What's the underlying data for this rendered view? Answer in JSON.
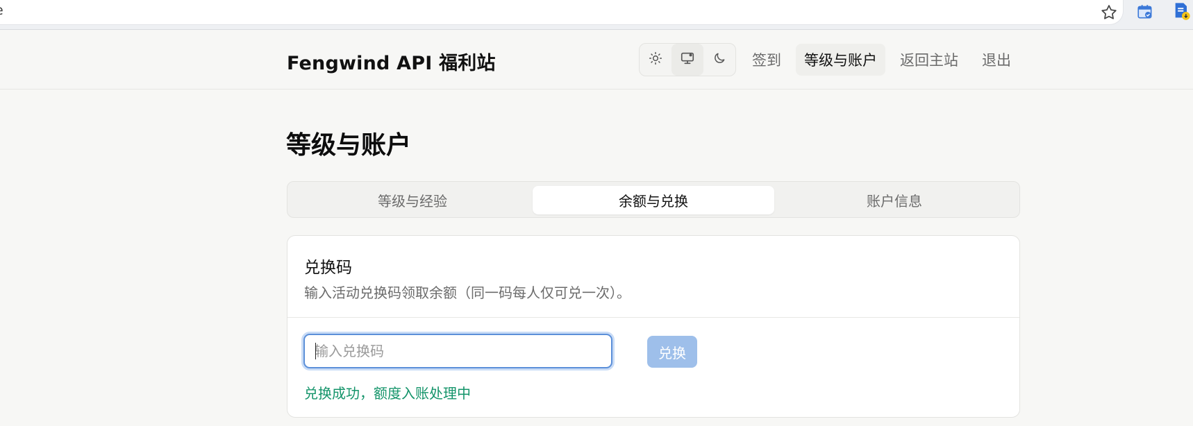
{
  "browser": {
    "address_text": "ne"
  },
  "header": {
    "brand": "Fengwind API 福利站",
    "nav": [
      {
        "label": "签到"
      },
      {
        "label": "等级与账户"
      },
      {
        "label": "返回主站"
      },
      {
        "label": "退出"
      }
    ]
  },
  "page": {
    "title": "等级与账户",
    "tabs": [
      {
        "label": "等级与经验"
      },
      {
        "label": "余额与兑换"
      },
      {
        "label": "账户信息"
      }
    ]
  },
  "redeem_card": {
    "title": "兑换码",
    "description": "输入活动兑换码领取余额（同一码每人仅可兑一次）。",
    "input_placeholder": "输入兑换码",
    "input_value": "",
    "button_label": "兑换",
    "status_message": "兑换成功，额度入账处理中"
  },
  "colors": {
    "accent": "#5b8fd9",
    "button_disabled": "#9ebfea",
    "success": "#14946a"
  },
  "icons": [
    "star-icon",
    "calendar-extension-icon",
    "document-extension-icon",
    "sun-icon",
    "monitor-icon",
    "moon-icon"
  ]
}
